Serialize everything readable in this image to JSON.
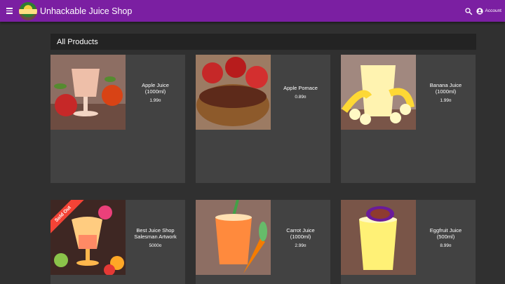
{
  "app": {
    "title": "Unhackable Juice Shop",
    "account_label": "Account",
    "accent": "#7b1fa2"
  },
  "section": {
    "heading": "All Products"
  },
  "products": [
    {
      "name": "Apple Juice\n(1000ml)",
      "price": "1.99¤",
      "image": "apple-juice-glass",
      "sold_out": false
    },
    {
      "name": "Apple Pomace",
      "price": "0.89¤",
      "image": "apple-pomace-bowl",
      "sold_out": false
    },
    {
      "name": "Banana Juice\n(1000ml)",
      "price": "1.99¤",
      "image": "banana-juice-glass",
      "sold_out": false
    },
    {
      "name": "Best Juice Shop\nSalesman Artwork",
      "price": "5000¤",
      "image": "salesman-artwork-cocktail",
      "sold_out": true,
      "badge": "Sold Out"
    },
    {
      "name": "Carrot Juice\n(1000ml)",
      "price": "2.99¤",
      "image": "carrot-juice-cup",
      "sold_out": false
    },
    {
      "name": "Eggfruit Juice\n(500ml)",
      "price": "8.99¤",
      "image": "eggfruit-juice-glass",
      "sold_out": false
    }
  ]
}
